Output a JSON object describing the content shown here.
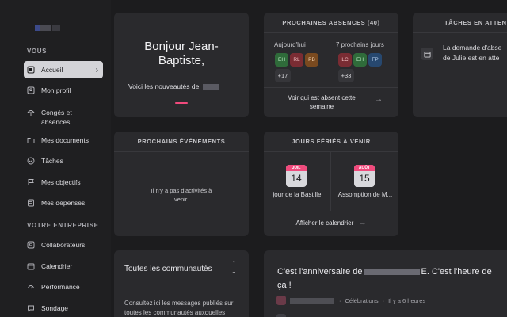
{
  "sidebar": {
    "section_vous": "VOUS",
    "section_entreprise": "VOTRE ENTREPRISE",
    "items": [
      {
        "label": "Accueil"
      },
      {
        "label": "Mon profil"
      },
      {
        "label": "Congés et absences"
      },
      {
        "label": "Mes documents"
      },
      {
        "label": "Tâches"
      },
      {
        "label": "Mes objectifs"
      },
      {
        "label": "Mes dépenses"
      },
      {
        "label": "Collaborateurs"
      },
      {
        "label": "Calendrier"
      },
      {
        "label": "Performance"
      },
      {
        "label": "Sondage"
      }
    ]
  },
  "welcome": {
    "greeting": "Bonjour Jean-Baptiste,",
    "subtitle": "Voici les nouveautés de"
  },
  "absences": {
    "title": "PROCHAINES ABSENCES (40)",
    "today_label": "Aujourd'hui",
    "next_label": "7 prochains jours",
    "today_badges": [
      "EH",
      "RL",
      "PB"
    ],
    "today_more": "+17",
    "next_badges": [
      "LC",
      "EH",
      "FP"
    ],
    "next_more": "+33",
    "link": "Voir qui est absent cette semaine"
  },
  "tasks": {
    "title": "TÂCHES EN ATTENTE",
    "line1": "La demande d'abse",
    "line2": "de Julie est en atte"
  },
  "events": {
    "title": "PROCHAINS ÉVÉNEMENTS",
    "empty": "Il n'y a pas d'activités à venir."
  },
  "holidays": {
    "title": "JOURS FÉRIÉS À VENIR",
    "items": [
      {
        "month": "JUIL",
        "day": "14",
        "name": "jour de la Bastille"
      },
      {
        "month": "AOÛT",
        "day": "15",
        "name": "Assomption de M..."
      }
    ],
    "link": "Afficher le calendrier"
  },
  "communities": {
    "title": "Toutes les communautés",
    "desc_line1": "Consultez ici les messages publiés sur",
    "desc_line2": "toutes les communautés auxquelles"
  },
  "post": {
    "line1_start": "C'est l'anniversaire de",
    "line1_end": "E. C'est l'heure de",
    "line2": "ça !",
    "category": "Célébrations",
    "time": "Il y a 6 heures"
  },
  "colors": {
    "accent": "#f04a7c",
    "badge_eh": "#2f6b3a",
    "badge_rl": "#7a2c33",
    "badge_pb": "#7a4a1f",
    "badge_lc": "#7a2c33",
    "badge_fp": "#27486f"
  }
}
